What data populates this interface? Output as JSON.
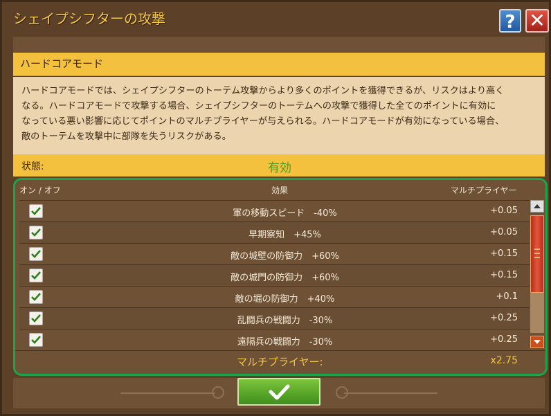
{
  "window": {
    "title": "シェイプシフターの攻撃",
    "help_label": "?",
    "close_label": "✕"
  },
  "section": {
    "header": "ハードコアモード",
    "description_lines": [
      "ハードコアモードでは、シェイプシフターのトーテム攻撃からより多くのポイントを獲得できるが、リスクはより高く",
      "なる。ハードコアモードで攻撃する場合、シェイプシフターのトーテムへの攻撃で獲得した全てのポイントに有効に",
      "なっている悪い影響に応じてポイントのマルチプライヤーが与えられる。ハードコアモードが有効になっている場合、",
      "敵のトーテムを攻撃中に部隊を失うリスクがある。"
    ]
  },
  "status": {
    "label": "状態:",
    "value": "有効"
  },
  "table": {
    "headers": {
      "toggle": "オン / オフ",
      "effect": "効果",
      "multiplier": "マルチプライヤー"
    },
    "rows": [
      {
        "checked": true,
        "effect": "軍の移動スピード　-40%",
        "multiplier": "+0.05"
      },
      {
        "checked": true,
        "effect": "早期察知　+45%",
        "multiplier": "+0.05"
      },
      {
        "checked": true,
        "effect": "敵の城壁の防御力　+60%",
        "multiplier": "+0.15"
      },
      {
        "checked": true,
        "effect": "敵の城門の防御力　+60%",
        "multiplier": "+0.15"
      },
      {
        "checked": true,
        "effect": "敵の堀の防御力　+40%",
        "multiplier": "+0.1"
      },
      {
        "checked": true,
        "effect": "乱闘兵の戦闘力　-30%",
        "multiplier": "+0.25"
      },
      {
        "checked": true,
        "effect": "遠隔兵の戦闘力　-30%",
        "multiplier": "+0.25"
      }
    ],
    "total_label": "マルチプライヤー:",
    "total_value": "x2.75"
  },
  "colors": {
    "accent_gold": "#f5c642",
    "status_green": "#4f9a1e",
    "panel_border": "#1da44a"
  }
}
